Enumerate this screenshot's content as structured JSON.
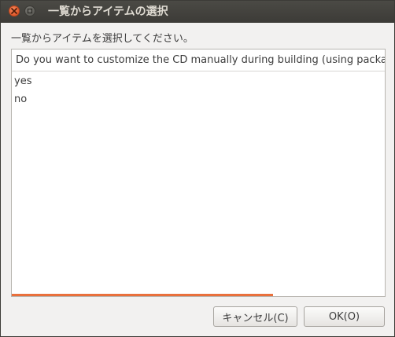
{
  "window": {
    "title": "一覧からアイテムの選択"
  },
  "dialog": {
    "prompt": "一覧からアイテムを選択してください。",
    "list": {
      "column_header": "Do you want to customize the CD manually during building (using package",
      "items": [
        {
          "label": "yes"
        },
        {
          "label": "no"
        }
      ],
      "progress_fraction": 0.7
    }
  },
  "buttons": {
    "cancel_label": "キャンセル(C)",
    "ok_label": "OK(O)"
  },
  "colors": {
    "titlebar": "#3c3b37",
    "close_button": "#e0582b",
    "progress": "#e9703c"
  },
  "icons": {
    "close": "close-icon",
    "minimize": "minimize-icon"
  }
}
